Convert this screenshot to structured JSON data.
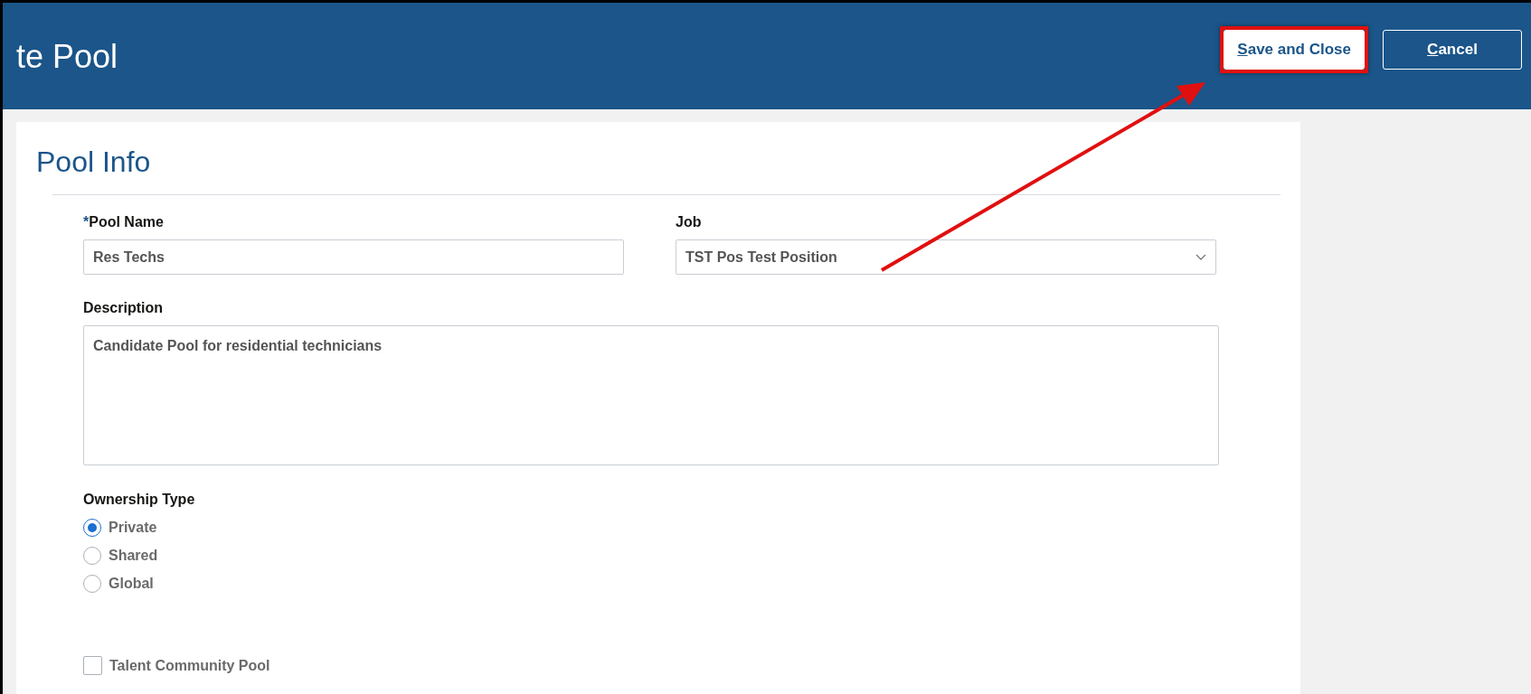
{
  "header": {
    "title": "te Pool",
    "buttons": [
      {
        "label": "Save and Close",
        "kind": "primary"
      },
      {
        "label": "Cancel",
        "kind": "secondary"
      }
    ]
  },
  "annotation": {
    "highlight_box": true,
    "arrow": true
  },
  "section": {
    "title": "Pool Info"
  },
  "fields": [
    {
      "kind": "text",
      "required_mark": "*",
      "label": "Pool Name",
      "value": "Res Techs"
    },
    {
      "kind": "select",
      "label": "Job",
      "value": "TST Pos Test Position"
    },
    {
      "kind": "textarea",
      "label": "Description",
      "value": "Candidate Pool for residential technicians"
    }
  ],
  "ownership": {
    "label": "Ownership Type",
    "options": [
      {
        "label": "Private",
        "selected": true
      },
      {
        "label": "Shared",
        "selected": false
      },
      {
        "label": "Global",
        "selected": false
      }
    ]
  },
  "talent_community": {
    "label": "Talent Community Pool",
    "checked": false
  }
}
